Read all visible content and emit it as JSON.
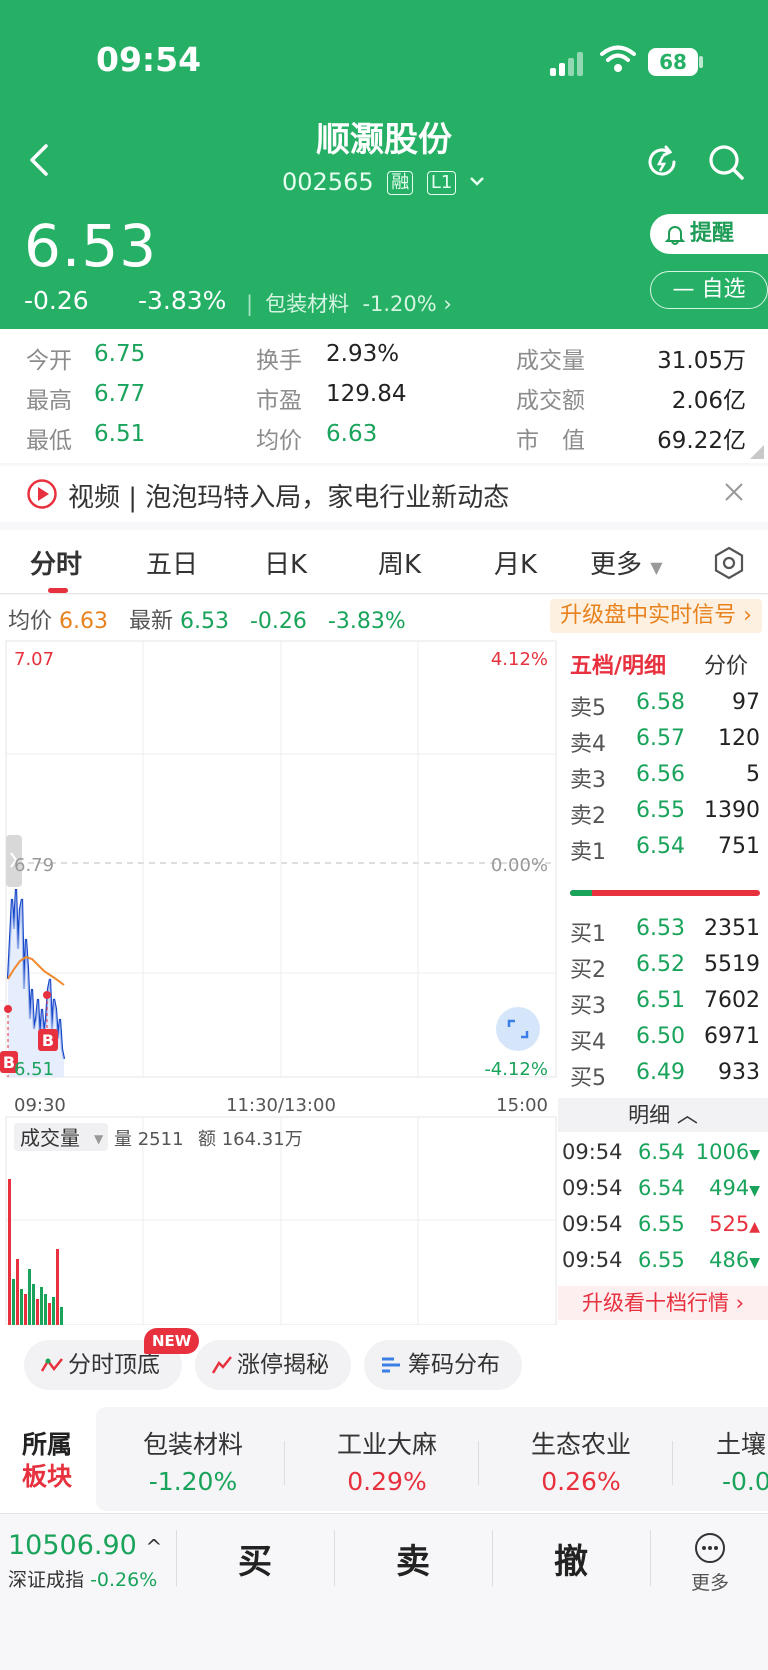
{
  "status": {
    "time": "09:54",
    "battery": "68"
  },
  "header": {
    "name": "顺灏股份",
    "code": "002565",
    "tag_margin": "融",
    "tag_level": "L1",
    "price": "6.53",
    "change": "-0.26",
    "change_pct": "-3.83%",
    "sector": "包装材料",
    "sector_change": "-1.20%",
    "remind_label": "提醒",
    "watch_label": "自选"
  },
  "stats": [
    {
      "label": "今开",
      "value": "6.75"
    },
    {
      "label": "最高",
      "value": "6.77"
    },
    {
      "label": "最低",
      "value": "6.51"
    },
    {
      "label": "换手",
      "value": "2.93%"
    },
    {
      "label": "市盈",
      "value": "129.84"
    },
    {
      "label": "均价",
      "value": "6.63"
    },
    {
      "label": "成交量",
      "value": "31.05万"
    },
    {
      "label": "成交额",
      "value": "2.06亿"
    },
    {
      "label": "市　值",
      "value": "69.22亿"
    }
  ],
  "news": {
    "text": "视频 | 泡泡玛特入局，家电行业新动态"
  },
  "tabs": [
    "分时",
    "五日",
    "日K",
    "周K",
    "月K",
    "更多"
  ],
  "chart": {
    "avg_label": "均价",
    "avg_value": "6.63",
    "latest_label": "最新",
    "latest_value": "6.53",
    "latest_change": "-0.26",
    "latest_pct": "-3.83%",
    "upgrade": "升级盘中实时信号",
    "y_high": "7.07",
    "y_mid": "6.79",
    "y_low": "6.51",
    "pct_high": "4.12%",
    "pct_mid": "0.00%",
    "pct_low": "-4.12%",
    "time_start": "09:30",
    "time_mid": "11:30/13:00",
    "time_end": "15:00",
    "vol_label": "成交量",
    "vol_text": "量 2511",
    "amt_text": "额 164.31万",
    "marker_b": "B"
  },
  "orderbook": {
    "tab_active": "五档/明细",
    "tab_other": "分价",
    "asks": [
      {
        "label": "卖5",
        "price": "6.58",
        "vol": "97"
      },
      {
        "label": "卖4",
        "price": "6.57",
        "vol": "120"
      },
      {
        "label": "卖3",
        "price": "6.56",
        "vol": "5"
      },
      {
        "label": "卖2",
        "price": "6.55",
        "vol": "1390"
      },
      {
        "label": "卖1",
        "price": "6.54",
        "vol": "751"
      }
    ],
    "bids": [
      {
        "label": "买1",
        "price": "6.53",
        "vol": "2351"
      },
      {
        "label": "买2",
        "price": "6.52",
        "vol": "5519"
      },
      {
        "label": "买3",
        "price": "6.51",
        "vol": "7602"
      },
      {
        "label": "买4",
        "price": "6.50",
        "vol": "6971"
      },
      {
        "label": "买5",
        "price": "6.49",
        "vol": "933"
      }
    ],
    "detail_label": "明细",
    "trades": [
      {
        "time": "09:54",
        "price": "6.54",
        "vol": "1006",
        "dir": "down"
      },
      {
        "time": "09:54",
        "price": "6.54",
        "vol": "494",
        "dir": "down"
      },
      {
        "time": "09:54",
        "price": "6.55",
        "vol": "525",
        "dir": "up"
      },
      {
        "time": "09:54",
        "price": "6.55",
        "vol": "486",
        "dir": "down"
      }
    ],
    "upgrade10": "升级看十档行情"
  },
  "tools": {
    "t1": "分时顶底",
    "t2": "涨停揭秘",
    "t3": "筹码分布",
    "new_badge": "NEW"
  },
  "sectors": {
    "title1": "所属",
    "title2": "板块",
    "items": [
      {
        "name": "包装材料",
        "change": "-1.20%"
      },
      {
        "name": "工业大麻",
        "change": "0.29%"
      },
      {
        "name": "生态农业",
        "change": "0.26%"
      },
      {
        "name": "土壤",
        "change": "-0.0"
      }
    ]
  },
  "bottom": {
    "index_value": "10506.90",
    "index_name": "深证成指",
    "index_change": "-0.26%",
    "buy": "买",
    "sell": "卖",
    "cancel": "撤",
    "more": "更多"
  }
}
